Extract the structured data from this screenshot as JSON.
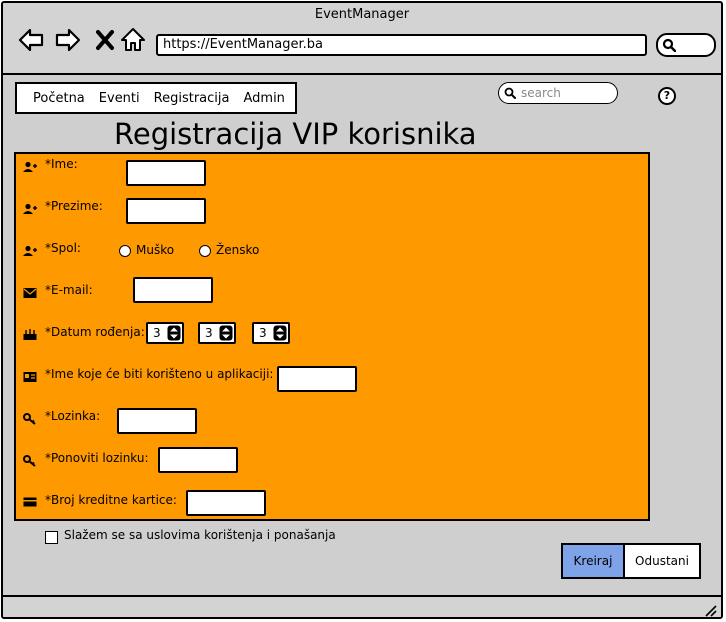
{
  "window": {
    "title": "EventManager"
  },
  "browser": {
    "url": "https://EventManager.ba"
  },
  "nav": {
    "items": [
      "Početna",
      "Eventi",
      "Registracija",
      "Admin"
    ]
  },
  "search": {
    "placeholder": "search"
  },
  "help": {
    "label": "?"
  },
  "page": {
    "title": "Registracija VIP korisnika"
  },
  "form": {
    "ime_label": "*Ime:",
    "prezime_label": "*Prezime:",
    "spol_label": "*Spol:",
    "spol_options": [
      "Muško",
      "Žensko"
    ],
    "email_label": "*E-mail:",
    "datum_label": "*Datum rođenja:",
    "datum_values": [
      "3",
      "3",
      "3"
    ],
    "username_label": "*Ime koje će biti korišteno u aplikaciji:",
    "lozinka_label": "*Lozinka:",
    "ponoviti_label": "*Ponoviti lozinku:",
    "kartica_label": "*Broj kreditne kartice:"
  },
  "terms": {
    "label": "Slažem se sa uslovima korištenja i ponašanja"
  },
  "buttons": {
    "create": "Kreiraj",
    "cancel": "Odustani"
  },
  "colors": {
    "panel": "#ff9900",
    "primary_button": "#7fa3e8",
    "window": "#cfcfcf"
  }
}
